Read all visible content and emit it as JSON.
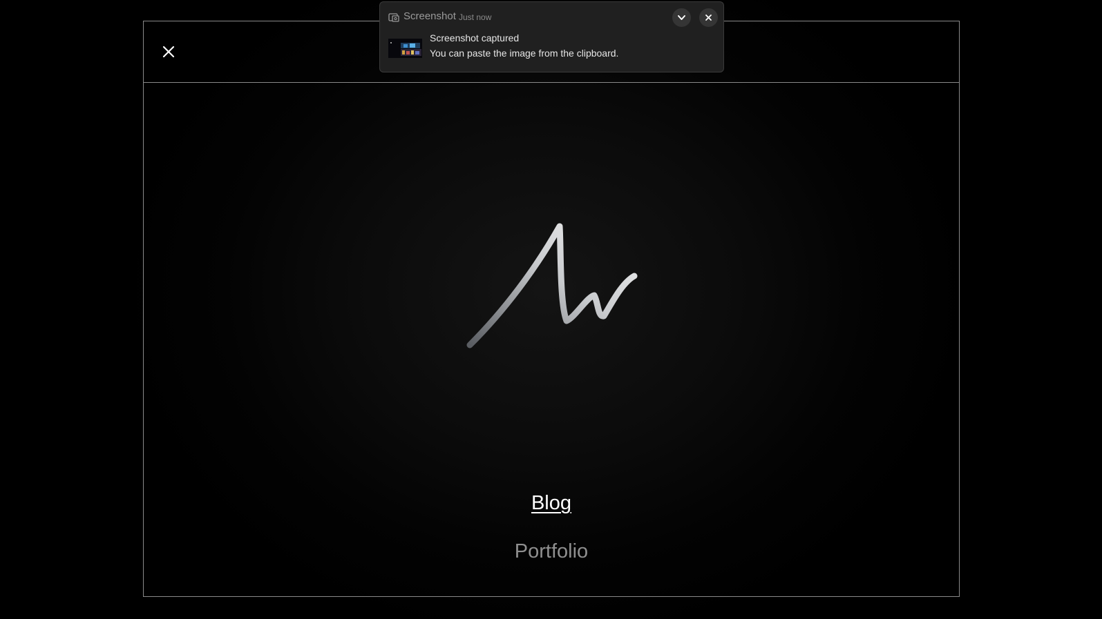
{
  "menu": {
    "close_icon": "close-icon",
    "logo_icon": "signature-logo",
    "items": [
      {
        "label": "Blog",
        "active": true
      },
      {
        "label": "Portfolio",
        "active": false
      }
    ]
  },
  "notification": {
    "app_name": "Screenshot",
    "time": "Just now",
    "title": "Screenshot captured",
    "body": "You can paste the image from the clipboard.",
    "app_icon": "screenshot-icon",
    "expand_icon": "chevron-down-icon",
    "dismiss_icon": "close-icon"
  },
  "colors": {
    "background": "#000000",
    "frame_border": "#8a8a8a",
    "active_link": "#ffffff",
    "inactive_link": "#8f8f8f",
    "notification_bg": "#202020"
  }
}
